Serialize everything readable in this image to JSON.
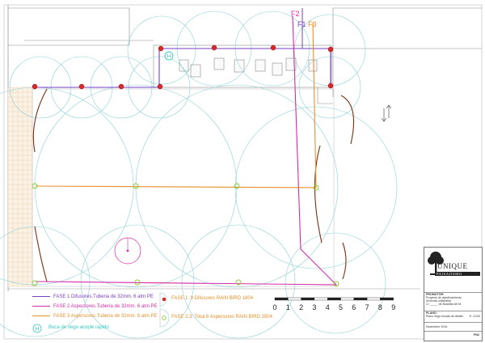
{
  "phase_labels": {
    "f1": "F1",
    "f2": "F2",
    "f3": "F3"
  },
  "legend": {
    "line1": "FASE 1 Difusores.Tuberia de 32mm. 6 atm PE",
    "line2": "FASE 2 Aspersores.Tuberia de 32mm. 6 atm PE",
    "line3": "FASE 3 Aspersores.Tuberia de 32mm. 6 atm PE",
    "valve_label": "Boca de riego acople rapido",
    "diffuser_label": "FASE 1: 9 Difusores RAIN BIRD 1804",
    "sprinkler_label": "FASE 2,3: Total 8 Aspersores RAIN BIRD 3504"
  },
  "scale_labels": [
    "0",
    "1",
    "2",
    "3",
    "4",
    "5",
    "6",
    "7",
    "8",
    "9"
  ],
  "valve_symbol": "H",
  "title_block": {
    "brand": "UNIQUE",
    "brand_sub": "PAISAJISMO",
    "promotor_header": "PROMOTOR:",
    "promotor_lines": [
      "Proyecto de ajardinamiento",
      "Vivienda unifamiliar",
      "C/ _____ de Boadilla del M.",
      "Boadilla del Monte"
    ],
    "plan_header": "PLANO:",
    "plan_line": "Plano riego escala de detalle",
    "scale_text": "E: 1/100",
    "date_line": "Noviembre 2016",
    "plan_no": "PN2"
  },
  "colors": {
    "fase1": "#7a3fc4",
    "fase2": "#d62aa8",
    "fase3": "#e7902a",
    "valve": "#35c9c2",
    "diffuser": "#d42a2a",
    "sprinkler": "#8fc93a",
    "coverage": "#8ed0d6",
    "hedge": "#7a2e12",
    "building": "#777777"
  }
}
